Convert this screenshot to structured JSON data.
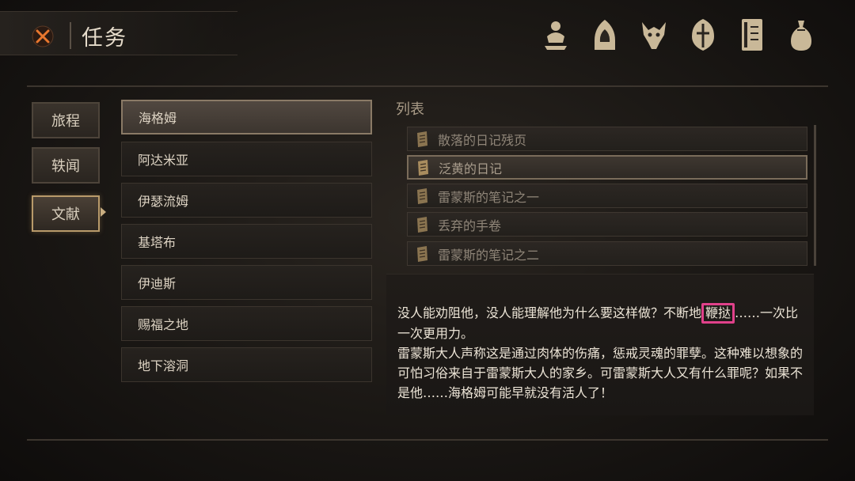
{
  "header": {
    "title": "任务"
  },
  "top_icons": [
    "character-icon",
    "hood-icon",
    "beast-skull-icon",
    "helmet-icon",
    "journal-icon",
    "bag-icon"
  ],
  "tabs": [
    {
      "label": "旅程",
      "active": false
    },
    {
      "label": "轶闻",
      "active": false
    },
    {
      "label": "文献",
      "active": true
    }
  ],
  "categories": [
    {
      "label": "海格姆",
      "active": true
    },
    {
      "label": "阿达米亚",
      "active": false
    },
    {
      "label": "伊瑟流姆",
      "active": false
    },
    {
      "label": "基塔布",
      "active": false
    },
    {
      "label": "伊迪斯",
      "active": false
    },
    {
      "label": "赐福之地",
      "active": false
    },
    {
      "label": "地下溶洞",
      "active": false
    }
  ],
  "list": {
    "label": "列表",
    "items": [
      {
        "label": "散落的日记残页",
        "active": false
      },
      {
        "label": "泛黄的日记",
        "active": true
      },
      {
        "label": "雷蒙斯的笔记之一",
        "active": false
      },
      {
        "label": "丢弃的手卷",
        "active": false
      },
      {
        "label": "雷蒙斯的笔记之二",
        "active": false
      }
    ]
  },
  "document": {
    "text_before": "没人能劝阻他，没人能理解他为什么要这样做？不断地",
    "highlight": "鞭挞",
    "text_after": "……一次比一次更用力。",
    "paragraph2": "雷蒙斯大人声称这是通过肉体的伤痛，惩戒灵魂的罪孽。这种难以想象的可怕习俗来自于雷蒙斯大人的家乡。可雷蒙斯大人又有什么罪呢？如果不是他……海格姆可能早就没有活人了！"
  },
  "colors": {
    "accent": "#b89a6a",
    "highlight_box": "#e0418a",
    "close_x": "#e8772e"
  }
}
